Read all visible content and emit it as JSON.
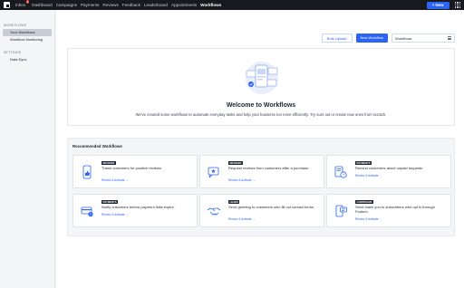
{
  "nav": {
    "items": [
      {
        "label": "Inbox",
        "badge": "4",
        "active": false
      },
      {
        "label": "Dashboard",
        "active": false
      },
      {
        "label": "Campaigns",
        "active": false
      },
      {
        "label": "Payments",
        "active": false
      },
      {
        "label": "Reviews",
        "active": false
      },
      {
        "label": "Feedback",
        "active": false
      },
      {
        "label": "Leaderboard",
        "active": false
      },
      {
        "label": "Appointments",
        "active": false
      },
      {
        "label": "Workflows",
        "active": true
      }
    ],
    "new_button": "+ New"
  },
  "sidebar": {
    "sections": [
      {
        "heading": "WORKFLOWS",
        "items": [
          {
            "label": "Your Workflows",
            "active": true
          },
          {
            "label": "Workflow Monitoring",
            "active": false
          }
        ]
      },
      {
        "heading": "SETTINGS",
        "items": [
          {
            "label": "Data Sync",
            "active": false
          }
        ]
      }
    ]
  },
  "toolbar": {
    "bulk_upload": "Bulk Upload",
    "new_workflow": "New Workflow",
    "select_value": "Workflows"
  },
  "welcome": {
    "title": "Welcome to Workflows",
    "subtitle": "We've created some workflows to automate everyday tasks and help your business run more efficiently. Try ours out or create new ones from scratch."
  },
  "recommended": {
    "title": "Recommended Workflows",
    "cards": [
      {
        "tag": "REVIEWS",
        "desc": "Thank customers for positive reviews.",
        "link": "Review & Activate →",
        "icon": "thumbs-up-phone-icon"
      },
      {
        "tag": "REVIEWS",
        "desc": "Request reviews from customers after a purchase.",
        "link": "Review & Activate →",
        "icon": "star-chat-icon"
      },
      {
        "tag": "PAYMENTS",
        "desc": "Remind customers about unpaid requests.",
        "link": "Review & Activate →",
        "icon": "invoice-clock-icon"
      },
      {
        "tag": "PAYMENTS",
        "desc": "Notify customers before payment links expire.",
        "link": "Review & Activate →",
        "icon": "card-alert-icon"
      },
      {
        "tag": "LEADS",
        "desc": "Send greeting to customers who fill out contact forms.",
        "link": "Review & Activate →",
        "icon": "handshake-icon"
      },
      {
        "tag": "CAMPAIGNS",
        "desc": "Send thank you to subscribers who opt in through Podium.",
        "link": "Review & Activate →",
        "icon": "phone-message-icon"
      }
    ]
  },
  "colors": {
    "accent": "#2c64f6",
    "nav_bg": "#17191f",
    "tag_bg": "#1d2433"
  }
}
